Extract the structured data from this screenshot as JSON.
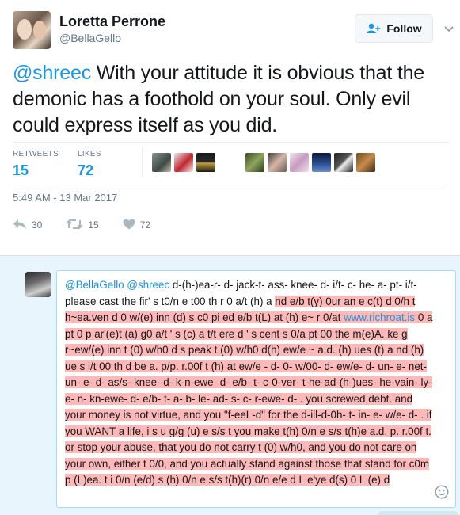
{
  "author": {
    "display_name": "Loretta Perrone",
    "handle": "@BellaGello"
  },
  "follow_button": {
    "label": "Follow"
  },
  "tweet": {
    "mention": "@shreec",
    "text": " With your attitude it is obvious that the demonic has a foothold on your soul. Only evil could express itself as you did."
  },
  "stats": {
    "retweets_label": "RETWEETS",
    "retweets_value": "15",
    "likes_label": "LIKES",
    "likes_value": "72"
  },
  "timestamp": "5:49 AM - 13 Mar 2017",
  "actions": {
    "reply_count": "30",
    "retweet_count": "15",
    "like_count": "72"
  },
  "reply": {
    "mentions": "@BellaGello @shreec",
    "plain_text": " d-(h-)ea-r- d- jack-t- ass- knee- d- i/t- c- he- a- pt- i/t- please cast the fir' s t0/n e t00 th r 0 a/t (h) a ",
    "over_text_1": "nd e/b t(y) 0ur an e c(t) d 0/h t h~ea.ven d 0 w/(e) inn (d) s c0 pi ed e/b t(L) at (h) e~ r 0/at ",
    "link": "www.richroat.is",
    "over_text_2": " 0 a pt 0 p ar'(e)t (a) g0 a/t ' s (c) a t/t ere d ' s cent s 0/a pt 00 the m(e)A. ke g r~ew/(e) inn t (0) w/h0 d s peak t (0) w/h0 d(h) ew/e ~ a.d. (h) ues (t) a nd (h) ue s i/t 00 th d be a. p/p. r.00f t (h) at ew/e - d- 0- w/00- d- ew/e- d- un- e- net- un- e- d- as/s- knee- d- k-n-ewe- d- e/b- t- c-0-ver- t-he-ad-(h-)ues- he-vain- ly- e- n- kn-ewe- d- e/b- t- a- b- le- ad- s- c- r-ewe- d- . you screwed debt. and your money is not virtue, and you \"f-eeL-d\" for the d-ill-d-0h- t- in- e- w/e- d- . if you WANT a life, i s u g/g (u) e s/s t you make t(h) 0/n e s/s t(h)e a.d.  p. r.00f t. or stop your abuse, that you do not carry t (0) w/h0, and you do not care on your own, either t 0/0, and you actually stand against those that stand for c0m p (L)ea. t i 0/n (e/d) s (h) 0/n e s/s t(h)(r) 0/n e/e d L e'ye d(s) 0 L (e) d"
  },
  "icons": {
    "follow": "add-user-icon",
    "caret": "chevron-down-icon",
    "reply": "reply-icon",
    "retweet": "retweet-icon",
    "like": "heart-icon",
    "emoji": "smiley-icon"
  },
  "colors": {
    "accent": "#1b95e0",
    "overflow_highlight": "#ffb8b8",
    "reply_area": "#e8f5fd"
  }
}
